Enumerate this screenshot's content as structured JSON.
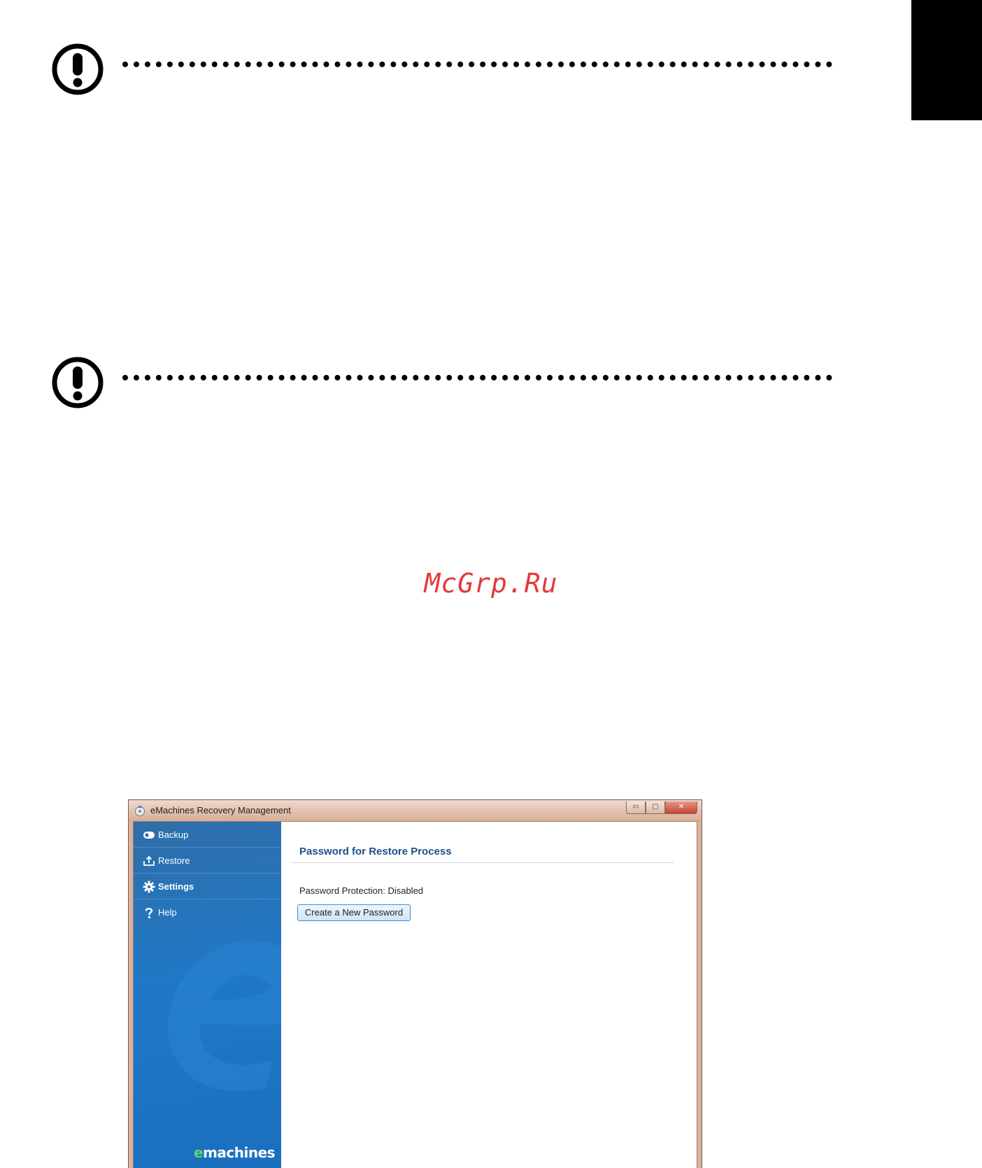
{
  "window": {
    "title": "eMachines Recovery Management",
    "controls": {
      "minimize_glyph": "▭",
      "maximize_glyph": "▢",
      "close_glyph": "✕"
    }
  },
  "sidebar": {
    "items": [
      {
        "label": "Backup",
        "icon": "backup-icon",
        "active": false
      },
      {
        "label": "Restore",
        "icon": "restore-icon",
        "active": false
      },
      {
        "label": "Settings",
        "icon": "gear-icon",
        "active": true
      },
      {
        "label": "Help",
        "icon": "help-icon",
        "active": false
      }
    ],
    "brand_prefix": "e",
    "brand_suffix": "machines"
  },
  "main": {
    "heading": "Password for Restore Process",
    "status": "Password Protection: Disabled",
    "create_button_label": "Create a New Password"
  },
  "watermark": "McGrp.Ru",
  "colors": {
    "sidebar": "#1f78c7",
    "heading": "#1d4f8a",
    "title_bar": "#d8ad98",
    "watermark": "#e23a3a"
  }
}
